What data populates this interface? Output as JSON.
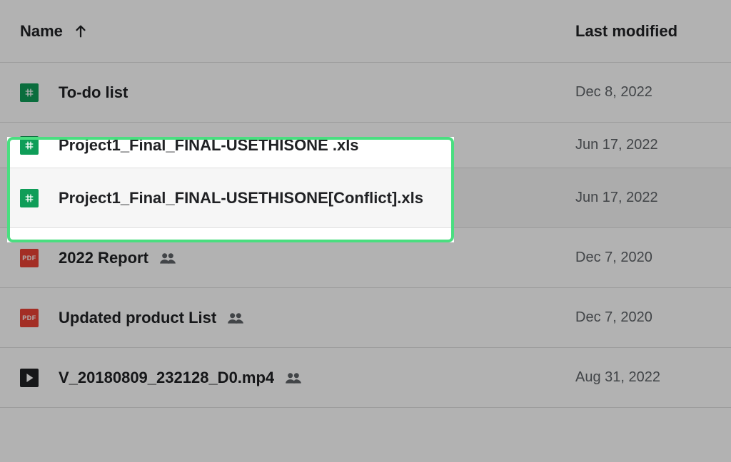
{
  "columns": {
    "name": "Name",
    "last_modified": "Last modified"
  },
  "sort_direction": "ascending",
  "files": [
    {
      "type": "sheets",
      "name": "To-do list",
      "modified": "Dec 8, 2022",
      "shared": false
    },
    {
      "type": "sheets",
      "name": "Project1_Final_FINAL-USETHISONE .xls",
      "modified": "Jun 17, 2022",
      "shared": false,
      "highlighted": true
    },
    {
      "type": "sheets",
      "name": "Project1_Final_FINAL-USETHISONE[Conflict].xls",
      "modified": "Jun 17, 2022",
      "shared": false,
      "highlighted": true
    },
    {
      "type": "pdf",
      "name": "2022 Report",
      "modified": "Dec 7, 2020",
      "shared": true
    },
    {
      "type": "pdf",
      "name": "Updated product List",
      "modified": "Dec 7, 2020",
      "shared": true
    },
    {
      "type": "video",
      "name": "V_20180809_232128_D0.mp4",
      "modified": "Aug 31, 2022",
      "shared": true
    }
  ],
  "pdf_badge": "PDF"
}
